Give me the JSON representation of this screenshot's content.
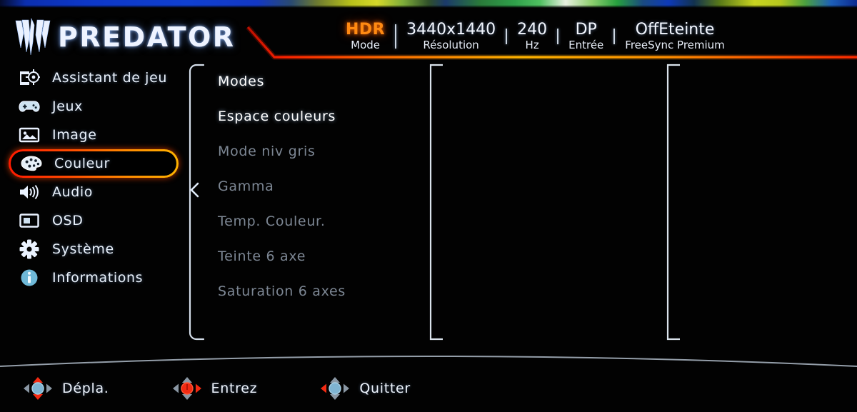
{
  "brand": {
    "name": "PREDATOR",
    "logo_icon": "predator-logo-icon"
  },
  "status_bar": {
    "items": [
      {
        "value": "HDR",
        "label": "Mode",
        "accent": "#ff8a12"
      },
      {
        "value": "3440x1440",
        "label": "Résolution"
      },
      {
        "value": "240",
        "label": "Hz"
      },
      {
        "value": "DP",
        "label": "Entrée"
      },
      {
        "value": "OffEteinte",
        "label": "FreeSync Premium"
      }
    ]
  },
  "sidebar": {
    "items": [
      {
        "label": "Assistant de jeu",
        "icon": "game-assist-icon",
        "selected": false
      },
      {
        "label": "Jeux",
        "icon": "gamepad-icon",
        "selected": false
      },
      {
        "label": "Image",
        "icon": "picture-icon",
        "selected": false
      },
      {
        "label": "Couleur",
        "icon": "palette-icon",
        "selected": true
      },
      {
        "label": "Audio",
        "icon": "speaker-icon",
        "selected": false
      },
      {
        "label": "OSD",
        "icon": "osd-icon",
        "selected": false
      },
      {
        "label": "Système",
        "icon": "gear-icon",
        "selected": false
      },
      {
        "label": "Informations",
        "icon": "info-icon",
        "selected": false
      }
    ]
  },
  "submenu": {
    "items": [
      {
        "label": "Modes",
        "state": "active"
      },
      {
        "label": "Espace couleurs",
        "state": "active"
      },
      {
        "label": "Mode niv gris",
        "state": "dim"
      },
      {
        "label": "Gamma",
        "state": "dim"
      },
      {
        "label": "Temp. Couleur.",
        "state": "dim"
      },
      {
        "label": "Teinte 6 axe",
        "state": "dim"
      },
      {
        "label": "Saturation 6 axes",
        "state": "dim"
      }
    ]
  },
  "bottom_hints": [
    {
      "label": "Dépla.",
      "icon": "dpad-updown-icon"
    },
    {
      "label": "Entrez",
      "icon": "dpad-right-icon"
    },
    {
      "label": "Quitter",
      "icon": "dpad-left-icon"
    }
  ],
  "colors": {
    "accent_red": "#ff1a00",
    "accent_orange": "#ff8c00",
    "hdr_orange": "#ff8a12",
    "text_bright": "#eef3ff",
    "text_dim": "#7d8794",
    "background": "#020202"
  }
}
